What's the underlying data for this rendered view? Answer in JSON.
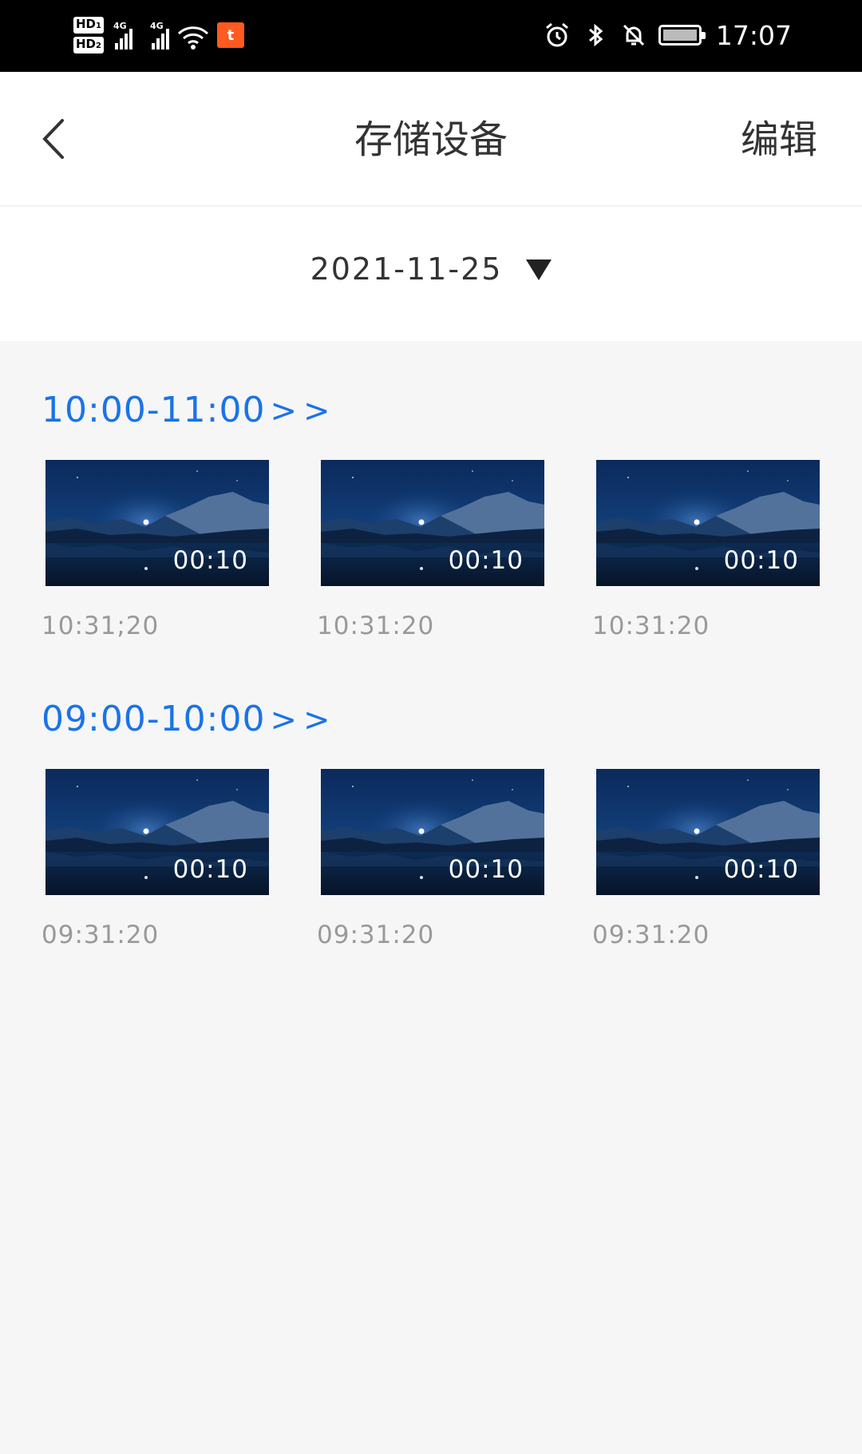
{
  "status_bar": {
    "hd1": "HD",
    "hd1_sub": "1",
    "hd2": "HD",
    "hd2_sub": "2",
    "net1": "4G",
    "net2": "4G",
    "app_badge": "t",
    "time": "17:07"
  },
  "header": {
    "title": "存储设备",
    "edit_label": "编辑"
  },
  "date_selector": {
    "date": "2021-11-25"
  },
  "groups": [
    {
      "title": "10:00-11:00",
      "chevron": ">>",
      "items": [
        {
          "duration": "00:10",
          "time": "10:31;20"
        },
        {
          "duration": "00:10",
          "time": "10:31:20"
        },
        {
          "duration": "00:10",
          "time": "10:31:20"
        }
      ]
    },
    {
      "title": "09:00-10:00",
      "chevron": ">>",
      "items": [
        {
          "duration": "00:10",
          "time": "09:31:20"
        },
        {
          "duration": "00:10",
          "time": "09:31:20"
        },
        {
          "duration": "00:10",
          "time": "09:31:20"
        }
      ]
    }
  ],
  "colors": {
    "accent": "#1a73e8",
    "status_app_badge": "#ff5a1f"
  }
}
